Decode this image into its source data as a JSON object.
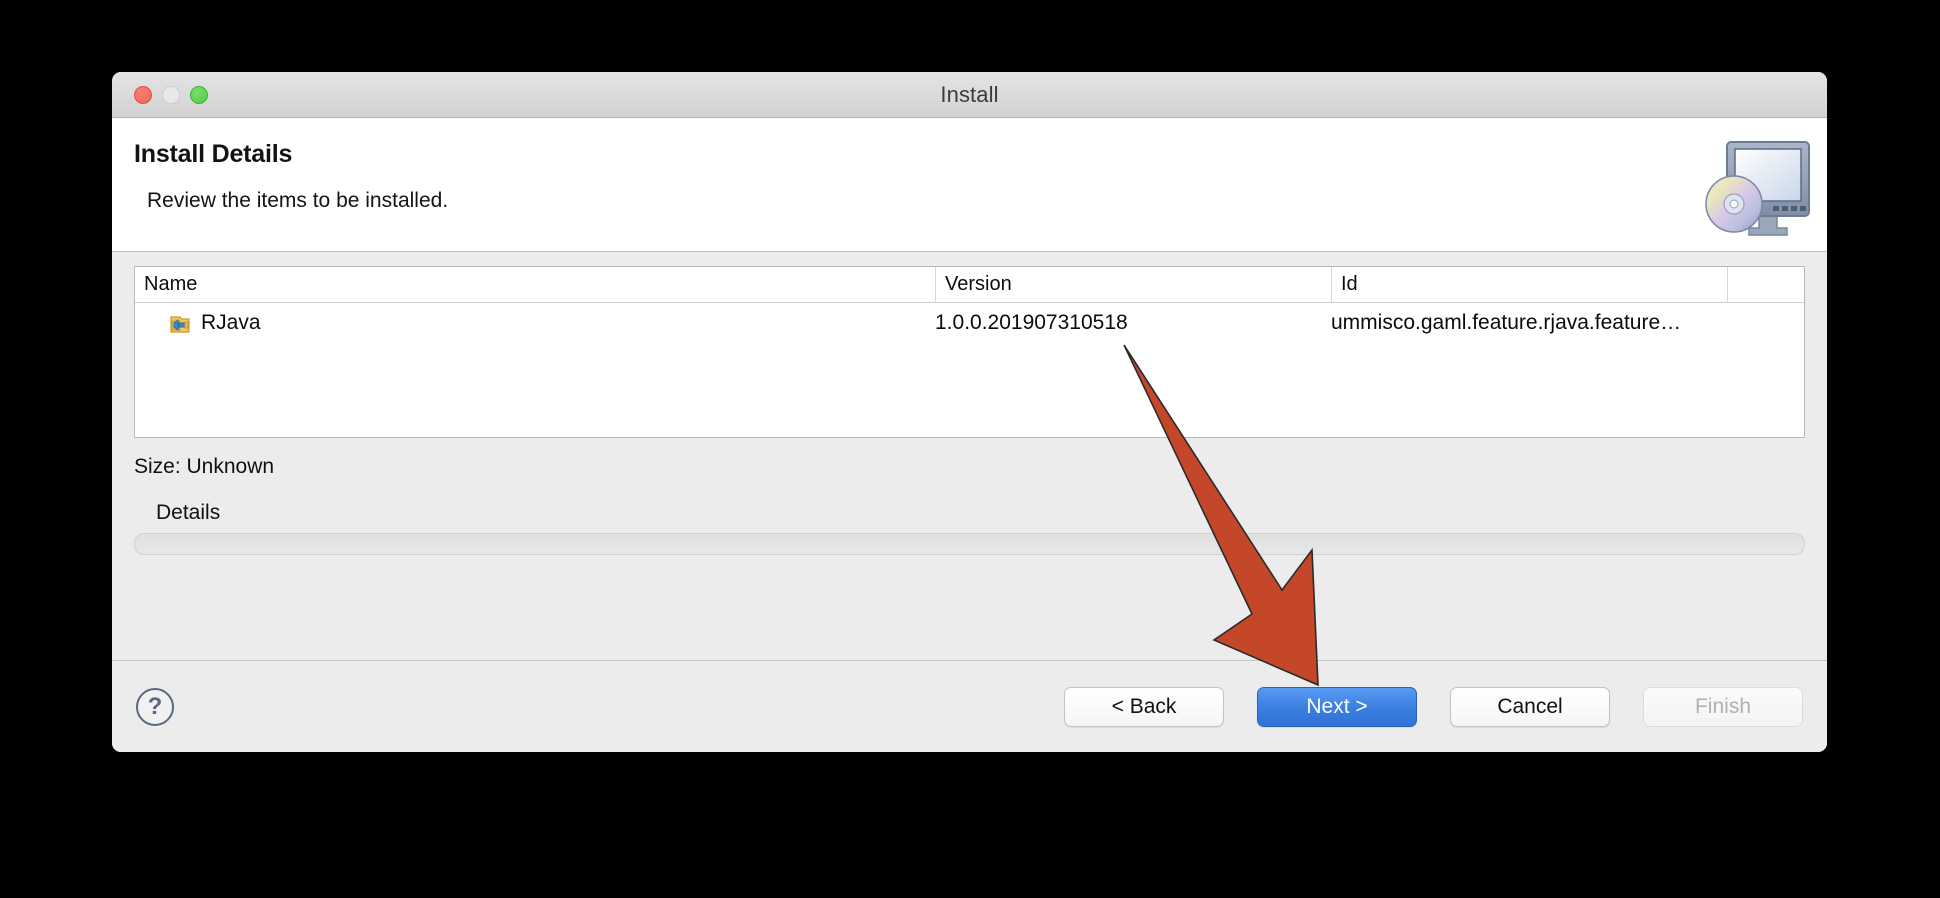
{
  "window": {
    "title": "Install",
    "controls": {
      "close": "close-button",
      "minimize": "minimize-button",
      "maximize": "maximize-button"
    }
  },
  "header": {
    "title": "Install Details",
    "subtitle": "Review the items to be installed.",
    "icon": "install-monitor-disc-icon"
  },
  "table": {
    "columns": [
      "Name",
      "Version",
      "Id",
      ""
    ],
    "rows": [
      {
        "icon": "feature-plugin-icon",
        "name": "RJava",
        "version": "1.0.0.201907310518",
        "id": "ummisco.gaml.feature.rjava.feature…"
      }
    ]
  },
  "status": {
    "size": "Size: Unknown",
    "details_label": "Details",
    "details_value": ""
  },
  "footer": {
    "help": "?",
    "back": "< Back",
    "next": "Next >",
    "cancel": "Cancel",
    "finish": "Finish"
  },
  "annotation": {
    "type": "arrow",
    "points_to": "next-button",
    "color": "#c4472a"
  },
  "colors": {
    "accent": "#3a7fe0",
    "annotation": "#c4472a",
    "window_bg": "#ececec",
    "panel_bg": "#ffffff"
  }
}
